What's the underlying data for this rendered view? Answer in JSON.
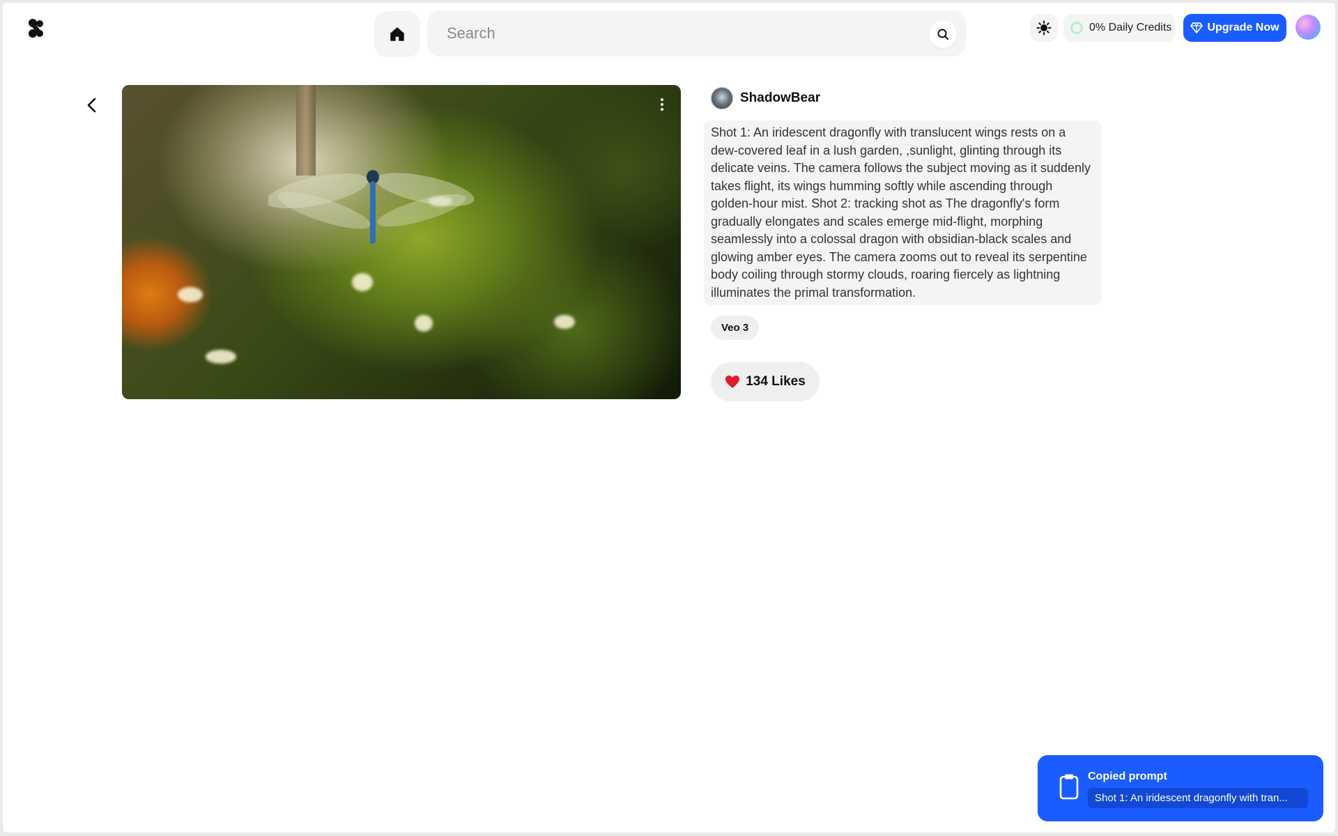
{
  "header": {
    "search_placeholder": "Search",
    "credits_label": "0% Daily Credits",
    "upgrade_label": "Upgrade Now"
  },
  "post": {
    "author": "ShadowBear",
    "prompt": "Shot 1: An iridescent dragonfly with translucent wings rests on a dew-covered leaf in a lush garden, ,sunlight, glinting through its delicate veins. The camera follows the subject moving as it suddenly takes flight, its wings humming softly while ascending through golden-hour mist. Shot 2: tracking shot as The dragonfly's form gradually elongates and scales emerge mid-flight, morphing seamlessly into a colossal dragon with obsidian-black scales and glowing amber eyes. The camera zooms out to reveal its serpentine body coiling through stormy clouds, roaring fiercely as lightning illuminates the primal transformation.",
    "model_tag": "Veo 3",
    "likes_label": "134 Likes"
  },
  "toast": {
    "title": "Copied prompt",
    "snippet": "Shot 1: An iridescent dragonfly with tran..."
  },
  "colors": {
    "accent": "#1a5cff",
    "like_heart": "#e11d2a",
    "credits_ring": "#b9efc8"
  },
  "icons": [
    "logo-icon",
    "home-icon",
    "search-icon",
    "sun-icon",
    "gem-icon",
    "chevron-left-icon",
    "more-vertical-icon",
    "heart-icon",
    "clipboard-icon"
  ]
}
